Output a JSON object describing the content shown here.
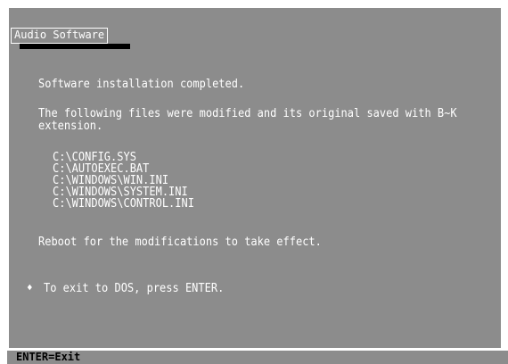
{
  "title": "Audio Software",
  "message": {
    "completed": "Software installation completed.",
    "files_line1": "The following files were modified and its original saved with B~K",
    "files_line2": "extension.",
    "files": [
      "C:\\CONFIG.SYS",
      "C:\\AUTOEXEC.BAT",
      "C:\\WINDOWS\\WIN.INI",
      "C:\\WINDOWS\\SYSTEM.INI",
      "C:\\WINDOWS\\CONTROL.INI"
    ],
    "reboot": "Reboot for the modifications to take effect.",
    "exit_icon": "diamond-bullet-icon",
    "exit_glyph": "♦",
    "exit": "To exit to DOS, press ENTER."
  },
  "status_bar": {
    "text": "ENTER=Exit"
  },
  "colors": {
    "background": "#8c8c8c",
    "text": "#ffffff",
    "status_text": "#000000"
  }
}
